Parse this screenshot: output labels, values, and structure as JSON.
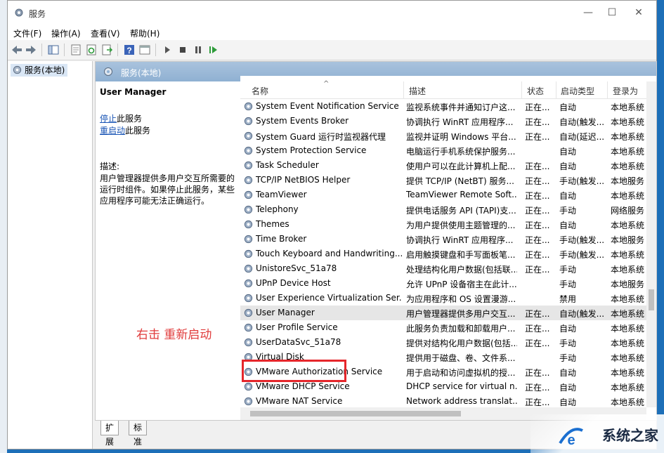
{
  "window": {
    "title": "服务"
  },
  "menu": [
    "文件(F)",
    "操作(A)",
    "查看(V)",
    "帮助(H)"
  ],
  "tree": {
    "item": "服务(本地)"
  },
  "content_header": "服务(本地)",
  "detail": {
    "service_name": "User Manager",
    "stop_link": "停止",
    "stop_suffix": "此服务",
    "restart_link": "重启动",
    "restart_suffix": "此服务",
    "desc_label": "描述:",
    "desc_text": "用户管理器提供多用户交互所需要的运行时组件。如果停止此服务，某些应用程序可能无法正确运行。"
  },
  "annotation": "右击 重新启动",
  "columns": [
    "名称",
    "描述",
    "状态",
    "启动类型",
    "登录为"
  ],
  "rows": [
    {
      "name": "System Event Notification Service",
      "desc": "监视系统事件并通知订户这...",
      "status": "正在...",
      "start": "自动",
      "logon": "本地系统"
    },
    {
      "name": "System Events Broker",
      "desc": "协调执行 WinRT 应用程序...",
      "status": "正在...",
      "start": "自动(触发...",
      "logon": "本地系统"
    },
    {
      "name": "System Guard 运行时监视器代理",
      "desc": "监视并证明 Windows 平台...",
      "status": "正在...",
      "start": "自动(延迟...",
      "logon": "本地系统"
    },
    {
      "name": "System Protection Service",
      "desc": "电脑运行手机系统保护服务...",
      "status": "",
      "start": "自动",
      "logon": "本地系统"
    },
    {
      "name": "Task Scheduler",
      "desc": "使用户可以在此计算机上配...",
      "status": "正在...",
      "start": "自动",
      "logon": "本地系统"
    },
    {
      "name": "TCP/IP NetBIOS Helper",
      "desc": "提供 TCP/IP (NetBT) 服务...",
      "status": "正在...",
      "start": "手动(触发...",
      "logon": "本地服务"
    },
    {
      "name": "TeamViewer",
      "desc": "TeamViewer Remote Soft...",
      "status": "正在...",
      "start": "自动",
      "logon": "本地系统"
    },
    {
      "name": "Telephony",
      "desc": "提供电话服务 API (TAPI)支...",
      "status": "正在...",
      "start": "手动",
      "logon": "网络服务"
    },
    {
      "name": "Themes",
      "desc": "为用户提供使用主题管理的...",
      "status": "正在...",
      "start": "自动",
      "logon": "本地系统"
    },
    {
      "name": "Time Broker",
      "desc": "协调执行 WinRT 应用程序...",
      "status": "正在...",
      "start": "手动(触发...",
      "logon": "本地服务"
    },
    {
      "name": "Touch Keyboard and Handwriting...",
      "desc": "启用触摸键盘和手写面板笔...",
      "status": "正在...",
      "start": "手动(触发...",
      "logon": "本地系统"
    },
    {
      "name": "UnistoreSvc_51a78",
      "desc": "处理结构化用户数据(包括联...",
      "status": "正在...",
      "start": "手动",
      "logon": "本地系统"
    },
    {
      "name": "UPnP Device Host",
      "desc": "允许 UPnP 设备宿主在此计...",
      "status": "",
      "start": "手动",
      "logon": "本地服务"
    },
    {
      "name": "User Experience Virtualization Ser...",
      "desc": "为应用程序和 OS 设置漫游...",
      "status": "",
      "start": "禁用",
      "logon": "本地系统"
    },
    {
      "name": "User Manager",
      "desc": "用户管理器提供多用户交互...",
      "status": "正在...",
      "start": "自动(触发...",
      "logon": "本地系统"
    },
    {
      "name": "User Profile Service",
      "desc": "此服务负责加载和卸载用户...",
      "status": "正在...",
      "start": "自动",
      "logon": "本地系统"
    },
    {
      "name": "UserDataSvc_51a78",
      "desc": "提供对结构化用户数据(包括...",
      "status": "正在...",
      "start": "手动",
      "logon": "本地系统"
    },
    {
      "name": "Virtual Disk",
      "desc": "提供用于磁盘、卷、文件系...",
      "status": "",
      "start": "手动",
      "logon": "本地系统"
    },
    {
      "name": "VMware Authorization Service",
      "desc": "用于启动和访问虚拟机的授...",
      "status": "正在...",
      "start": "自动",
      "logon": "本地系统"
    },
    {
      "name": "VMware DHCP Service",
      "desc": "DHCP service for virtual n...",
      "status": "正在...",
      "start": "自动",
      "logon": "本地系统"
    },
    {
      "name": "VMware NAT Service",
      "desc": "Network address translat...",
      "status": "正在...",
      "start": "自动",
      "logon": "本地系统"
    }
  ],
  "tabs": [
    "扩展",
    "标准"
  ],
  "watermark": "系统之家",
  "colors": {
    "highlight": "#e5262b",
    "annotation": "#e03c3c",
    "header": "#8fb0d2"
  }
}
